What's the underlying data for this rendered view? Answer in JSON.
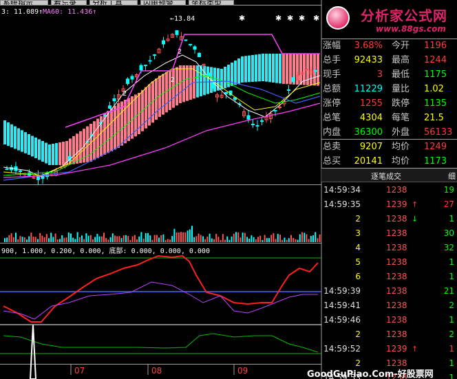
{
  "toolbar": {
    "tabs": [
      {
        "label": "系统指示"
      },
      {
        "label": "看忘录"
      },
      {
        "label": "分析工具"
      },
      {
        "label": "闪电预警"
      },
      {
        "label": "坐标类型"
      }
    ]
  },
  "main_panel": {
    "ma_header": [
      {
        "text": "3: 11.089↑",
        "color": "#ffffff"
      },
      {
        "text": "MA60: 11.436↑",
        "color": "#ff80ff"
      }
    ],
    "high_annotation": "←13.84",
    "arrow_markers": [
      "2",
      "2",
      "2"
    ]
  },
  "indicator_panel": {
    "params_text": "900, 1.000, 0.200, 0.000, 底部: 0.000, 0.000, 0.000"
  },
  "x_axis": {
    "labels": [
      "07",
      "08",
      "09"
    ]
  },
  "logo": {
    "title": "分析家公式网",
    "url": "www.88gs.com"
  },
  "quote_table": {
    "rows": [
      {
        "left_label": "涨幅",
        "left_value": "3.68%",
        "left_color": "#ff3b3b",
        "right_label": "今开",
        "right_value": "1196",
        "right_color": "#ff3b3b"
      },
      {
        "left_label": "总手",
        "left_value": "92433",
        "left_color": "#ffff00",
        "right_label": "最高",
        "right_value": "1244",
        "right_color": "#ff3b3b"
      },
      {
        "left_label": "现手",
        "left_value": "3",
        "left_color": "#ff3b3b",
        "right_label": "最低",
        "right_value": "1175",
        "right_color": "#00ff00"
      },
      {
        "left_label": "总额",
        "left_value": "11229",
        "left_color": "#00ffff",
        "right_label": "量比",
        "right_value": "1.02",
        "right_color": "#ffff00"
      },
      {
        "left_label": "涨停",
        "left_value": "1255",
        "left_color": "#ff3b3b",
        "right_label": "跌停",
        "right_value": "1135",
        "right_color": "#00ff00"
      },
      {
        "left_label": "总笔",
        "left_value": "4304",
        "left_color": "#ffff00",
        "right_label": "每笔",
        "right_value": "21.5",
        "right_color": "#ffff00"
      },
      {
        "left_label": "内盘",
        "left_value": "36300",
        "left_color": "#00ff00",
        "right_label": "外盘",
        "right_value": "56133",
        "right_color": "#ff3b3b"
      },
      {
        "left_label": "总卖",
        "left_value": "9207",
        "left_color": "#ffff00",
        "right_label": "均价",
        "right_value": "1249",
        "right_color": "#ff3b3b"
      },
      {
        "left_label": "总买",
        "left_value": "20141",
        "left_color": "#ffff00",
        "right_label": "均价",
        "right_value": "1173",
        "right_color": "#00ff00"
      }
    ]
  },
  "tick_list": {
    "header": "逐笔成交",
    "side_tab": "细",
    "rows": [
      {
        "time": "14:59:34",
        "price": "1238",
        "arrow": "",
        "arrow_color": "",
        "vol": "19",
        "vol_color": "#00ff00"
      },
      {
        "time": "14:59:35",
        "price": "1239",
        "arrow": "↑",
        "arrow_color": "#ff3b3b",
        "vol": "27",
        "vol_color": "#ff3b3b"
      },
      {
        "time": "2",
        "price": "1238",
        "arrow": "↓",
        "arrow_color": "#00ff00",
        "vol": "1",
        "vol_color": "#00ff00"
      },
      {
        "time": "3",
        "price": "1238",
        "arrow": "",
        "arrow_color": "",
        "vol": "30",
        "vol_color": "#00ff00"
      },
      {
        "time": "4",
        "price": "1238",
        "arrow": "",
        "arrow_color": "",
        "vol": "32",
        "vol_color": "#00ff00"
      },
      {
        "time": "5",
        "price": "1238",
        "arrow": "",
        "arrow_color": "",
        "vol": "1",
        "vol_color": "#00ff00"
      },
      {
        "time": "6",
        "price": "1238",
        "arrow": "",
        "arrow_color": "",
        "vol": "1",
        "vol_color": "#00ff00"
      },
      {
        "time": "14:59:39",
        "price": "1238",
        "arrow": "",
        "arrow_color": "",
        "vol": "21",
        "vol_color": "#00ff00"
      },
      {
        "time": "14:59:41",
        "price": "1238",
        "arrow": "",
        "arrow_color": "",
        "vol": "2",
        "vol_color": "#00ff00"
      },
      {
        "time": "14:59:46",
        "price": "1238",
        "arrow": "",
        "arrow_color": "",
        "vol": "1",
        "vol_color": "#00ff00"
      },
      {
        "time": "2",
        "price": "1238",
        "arrow": "",
        "arrow_color": "",
        "vol": "2",
        "vol_color": "#00ff00"
      },
      {
        "time": "14:59:52",
        "price": "1239",
        "arrow": "↑",
        "arrow_color": "#ff3b3b",
        "vol": "1",
        "vol_color": "#ff3b3b"
      },
      {
        "time": "2",
        "price": "1238",
        "arrow": "",
        "arrow_color": "",
        "vol": "1",
        "vol_color": "#00ff00"
      },
      {
        "time": "14:59:53",
        "price": "1238",
        "arrow": "",
        "arrow_color": "",
        "vol": "1",
        "vol_color": "#00ff00"
      }
    ]
  },
  "watermark": "GoodGuPiao.Com-好股票网"
}
